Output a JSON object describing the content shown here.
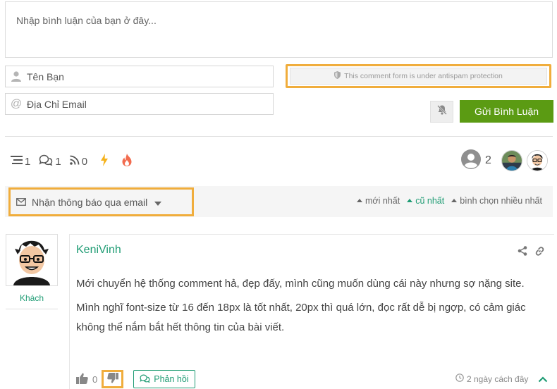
{
  "form": {
    "comment_placeholder": "Nhập bình luận của bạn ở đây...",
    "name_placeholder": "Tên Bạn",
    "email_placeholder": "Địa Chỉ Email",
    "antispam_notice": "This comment form is under antispam protection",
    "submit_label": "Gửi Bình Luận"
  },
  "stats": {
    "threads": "1",
    "replies": "1",
    "followers": "0"
  },
  "participants": {
    "count": "2"
  },
  "subscribe": {
    "label": "Nhận thông báo qua email"
  },
  "sorting": {
    "newest": "mới nhất",
    "oldest": "cũ nhất",
    "most_voted": "bình chọn nhiều nhất",
    "active": "oldest"
  },
  "comment": {
    "author": "KeniVinh",
    "role": "Khách",
    "paragraphs": [
      "Mới chuyển hệ thống comment hả, đẹp đấy, mình cũng muốn dùng cái này nhưng sợ nặng site.",
      "Mình nghĩ font-size từ 16 đến 18px là tốt nhất, 20px thì quá lớn, đọc rất dễ bị ngợp, có cảm giác không thể nắm bắt hết thông tin của bài viết."
    ],
    "votes": "0",
    "reply_label": "Phản hồi",
    "time": "2 ngày cách đây"
  },
  "colors": {
    "accent": "#1f9c74",
    "submit": "#5b9b13",
    "highlight": "#f0ad3c"
  }
}
